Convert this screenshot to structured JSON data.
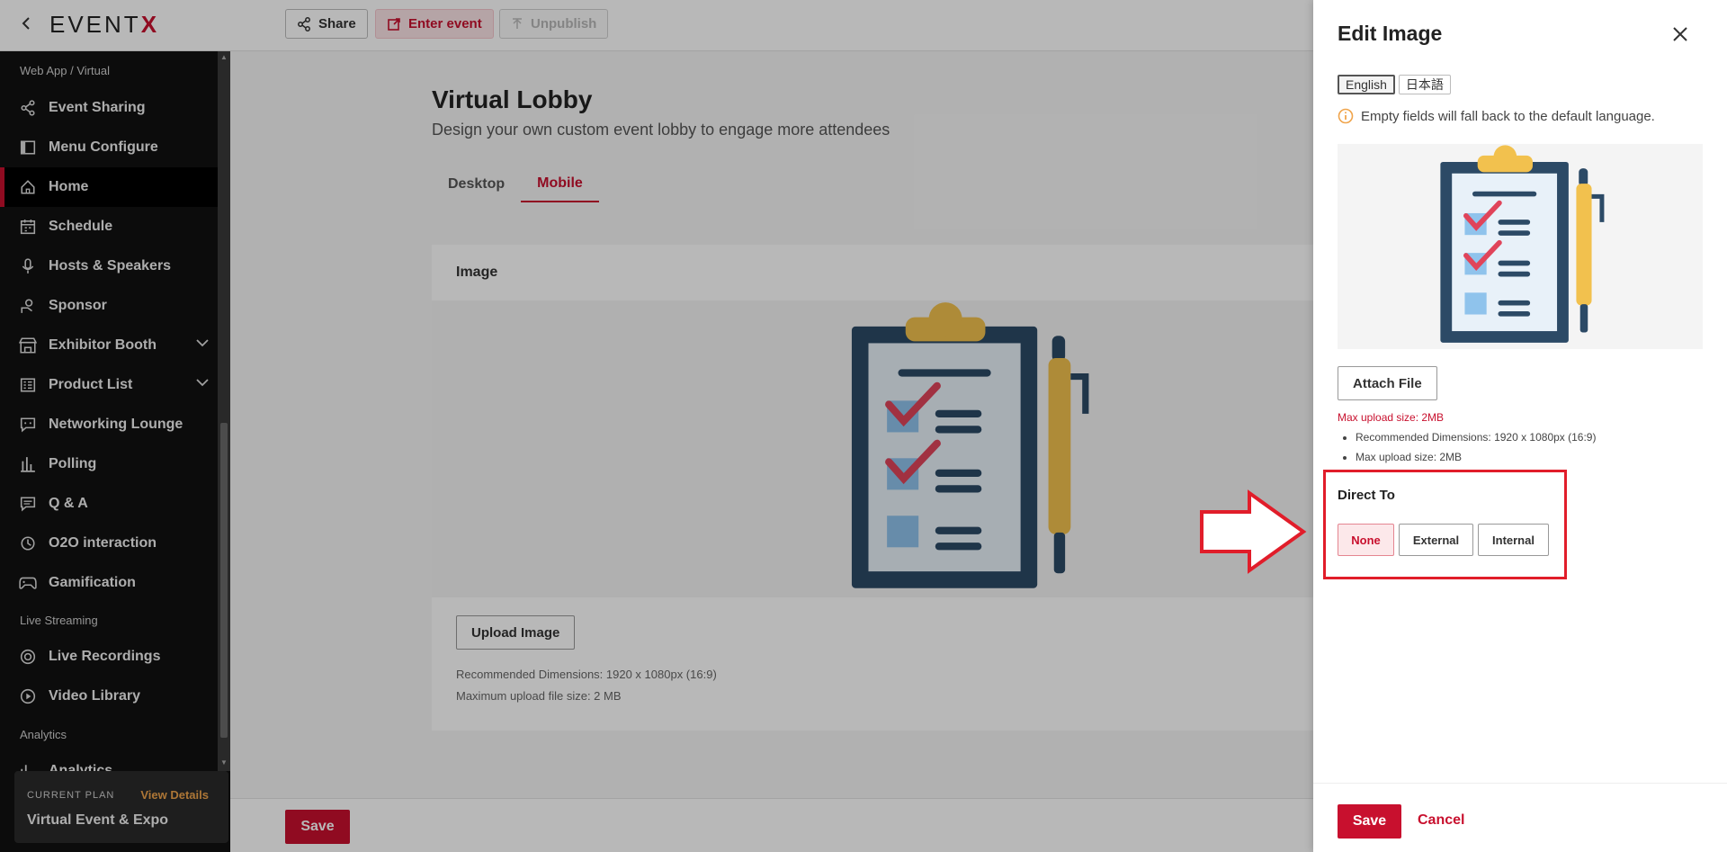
{
  "topbar": {
    "logo_main": "EVENT",
    "logo_x": "X",
    "share_label": "Share",
    "enter_label": "Enter event",
    "unpublish_label": "Unpublish"
  },
  "sidebar": {
    "section_webapp": "Web App / Virtual",
    "section_live": "Live Streaming",
    "section_analytics": "Analytics",
    "items": [
      {
        "label": "Event Sharing",
        "icon": "share-icon"
      },
      {
        "label": "Menu Configure",
        "icon": "layout-icon"
      },
      {
        "label": "Home",
        "icon": "home-icon"
      },
      {
        "label": "Schedule",
        "icon": "calendar-icon"
      },
      {
        "label": "Hosts & Speakers",
        "icon": "mic-icon"
      },
      {
        "label": "Sponsor",
        "icon": "sponsor-icon"
      },
      {
        "label": "Exhibitor Booth",
        "icon": "booth-icon"
      },
      {
        "label": "Product List",
        "icon": "list-icon"
      },
      {
        "label": "Networking Lounge",
        "icon": "chat-icon"
      },
      {
        "label": "Polling",
        "icon": "bar-chart-icon"
      },
      {
        "label": "Q & A",
        "icon": "qa-icon"
      },
      {
        "label": "O2O interaction",
        "icon": "o2o-icon"
      },
      {
        "label": "Gamification",
        "icon": "gamepad-icon"
      },
      {
        "label": "Live Recordings",
        "icon": "record-icon"
      },
      {
        "label": "Video Library",
        "icon": "video-icon"
      },
      {
        "label": "Analytics",
        "icon": "analytics-icon"
      }
    ],
    "plan": {
      "label": "CURRENT PLAN",
      "link": "View Details",
      "name": "Virtual Event & Expo"
    }
  },
  "main": {
    "title": "Virtual Lobby",
    "subtitle": "Design your own custom event lobby to engage more attendees",
    "tabs": [
      "Desktop",
      "Mobile"
    ],
    "active_tab": "Mobile",
    "card_label": "Image",
    "upload_label": "Upload Image",
    "hint_dimensions": "Recommended Dimensions: 1920 x 1080px (16:9)",
    "hint_size": "Maximum upload file size: 2 MB",
    "save_label": "Save"
  },
  "drawer": {
    "title": "Edit Image",
    "languages": [
      "English",
      "日本語"
    ],
    "info": "Empty fields will fall back to the default language.",
    "attach_label": "Attach File",
    "max_error": "Max upload size: 2MB",
    "bullets": [
      "Recommended Dimensions: 1920 x 1080px (16:9)",
      "Max upload size: 2MB"
    ],
    "direct_to_label": "Direct To",
    "direct_options": [
      "None",
      "External",
      "Internal"
    ],
    "save_label": "Save",
    "cancel_label": "Cancel"
  },
  "colors": {
    "brand_red": "#c8102e",
    "annotation_red": "#e11d2a",
    "warning_orange": "#f0a44b"
  }
}
